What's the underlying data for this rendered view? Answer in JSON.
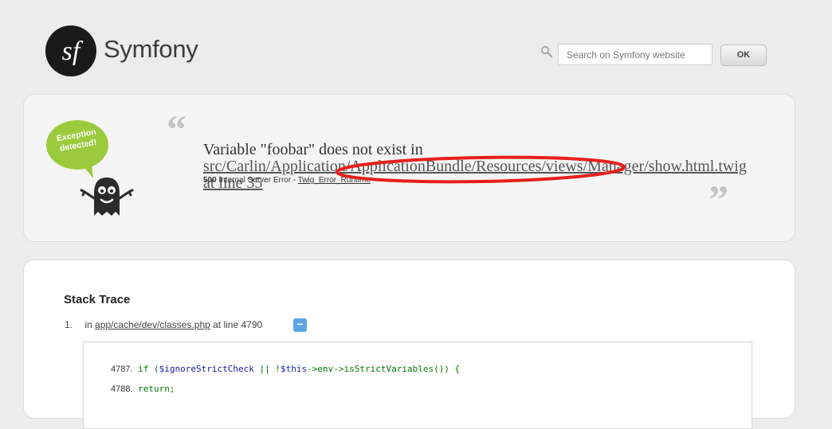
{
  "header": {
    "logo_text": "Symfony",
    "search_placeholder": "Search on Symfony website",
    "ok_label": "OK"
  },
  "exception": {
    "bubble_line1": "Exception",
    "bubble_line2": "detected!",
    "message_prefix": "Variable \"foobar\" does not exist in ",
    "message_path": "src/Carlin/Application/ApplicationBundle/Resources/views/Manager/show.html.twig at line 35",
    "status_code": "500",
    "status_text": "Internal Server Error - ",
    "exception_class": "Twig_Error_Runtime",
    "annotation_color": "#e8201d"
  },
  "trace": {
    "title": "Stack Trace",
    "items": [
      {
        "num": "1.",
        "prefix": "in ",
        "path": "app/cache/dev/classes.php",
        "suffix": " at line 4790",
        "toggle": "−"
      }
    ],
    "code_lines": [
      {
        "ln": "4787.",
        "code": "if (",
        "var1": "$ignoreStrictCheck",
        "mid": " || !",
        "var2": "$this",
        "rest": "->env->isStrictVariables()) {"
      },
      {
        "ln": "4788.",
        "code": "return;"
      }
    ]
  },
  "colors": {
    "accent_blue": "#5ba4e5",
    "bubble_green": "#9bcb3c"
  }
}
